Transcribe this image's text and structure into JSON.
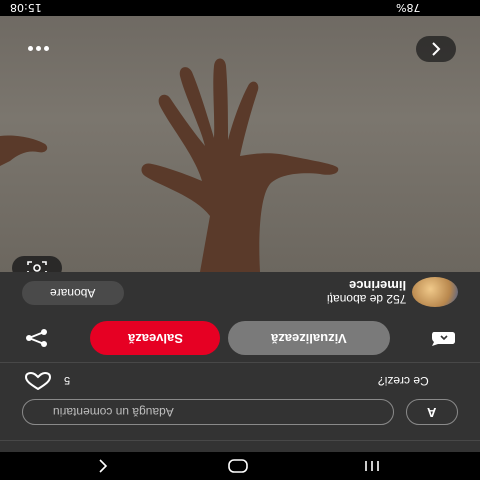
{
  "status_bar": {
    "time": "15:08",
    "battery": "78%"
  },
  "pin": {
    "author_name": "limerince",
    "subscribers": "752 de abonați",
    "follow_label": "Abonare",
    "visit_label": "Vizualizează",
    "save_label": "Salvează",
    "likes_count": "5",
    "comments_title": "Ce crezi?",
    "comment_placeholder": "Adaugă un comentariu",
    "user_initial": "A"
  },
  "icons": {
    "more": "more-dots-icon",
    "back": "chevron-left-icon",
    "lens": "visual-search-icon",
    "share": "share-icon",
    "chat": "chat-icon",
    "heart": "heart-icon"
  },
  "colors": {
    "save_red": "#e60023",
    "visit_gray": "#7a7a7a",
    "panel": "#333333"
  }
}
